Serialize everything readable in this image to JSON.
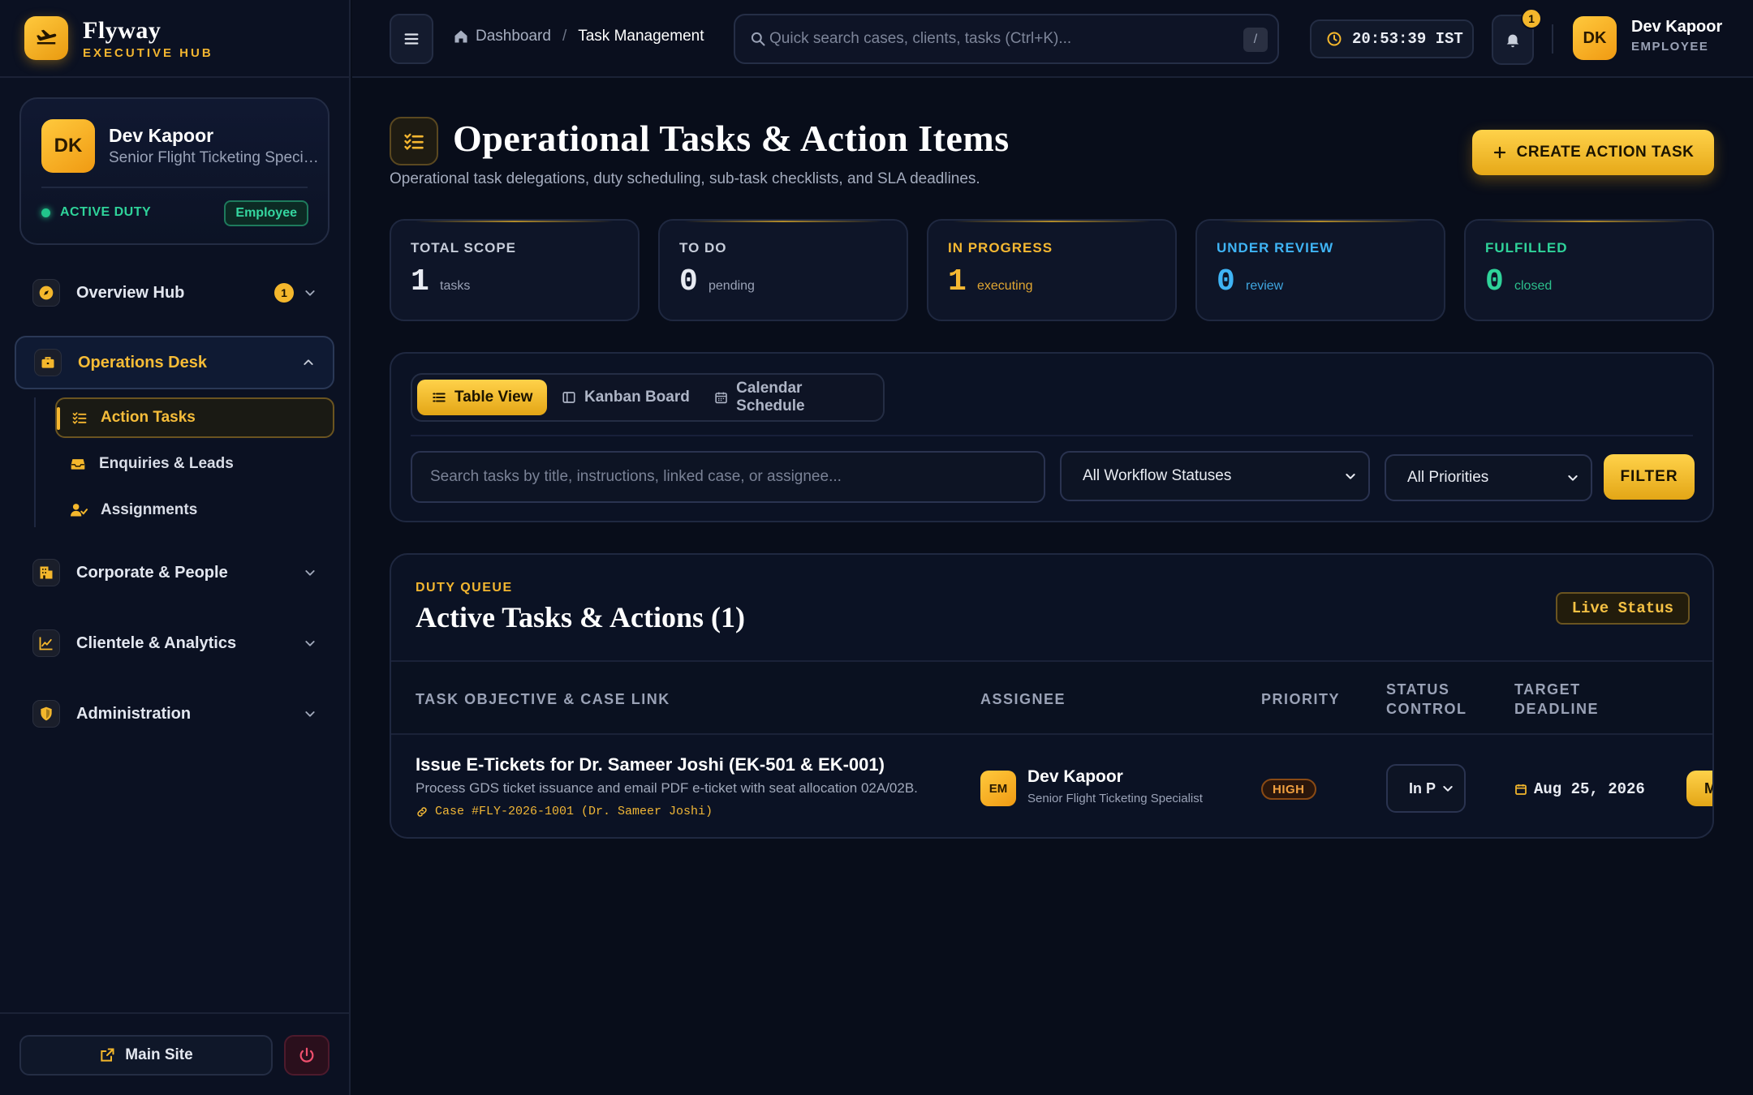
{
  "brand": {
    "name": "Flyway",
    "subtitle": "EXECUTIVE HUB"
  },
  "profile": {
    "initials": "DK",
    "name": "Dev Kapoor",
    "role": "Senior Flight Ticketing Specialist",
    "duty_status": "ACTIVE DUTY",
    "badge": "Employee"
  },
  "nav": {
    "overview": {
      "label": "Overview Hub",
      "count": "1"
    },
    "operations": {
      "label": "Operations Desk",
      "items": [
        {
          "label": "Action Tasks"
        },
        {
          "label": "Enquiries & Leads"
        },
        {
          "label": "Assignments"
        }
      ]
    },
    "corporate": {
      "label": "Corporate & People"
    },
    "clientele": {
      "label": "Clientele & Analytics"
    },
    "administration": {
      "label": "Administration"
    }
  },
  "footer": {
    "main_site": "Main Site"
  },
  "topbar": {
    "breadcrumb_home": "Dashboard",
    "breadcrumb_sep": "/",
    "breadcrumb_current": "Task Management",
    "search_placeholder": "Quick search cases, clients, tasks (Ctrl+K)...",
    "search_shortcut": "/",
    "clock": "20:53:39 IST",
    "notification_count": "1",
    "user_initials": "DK",
    "user_name": "Dev Kapoor",
    "user_role": "EMPLOYEE"
  },
  "page": {
    "title": "Operational Tasks & Action Items",
    "subtitle": "Operational task delegations, duty scheduling, sub-task checklists, and SLA deadlines.",
    "create_button": "CREATE ACTION TASK"
  },
  "stats": [
    {
      "label": "TOTAL SCOPE",
      "value": "1",
      "unit": "tasks",
      "color": "#e8ebf2",
      "label_color": "#c6ccd9",
      "unit_color": "#9aa2b6"
    },
    {
      "label": "TO DO",
      "value": "0",
      "unit": "pending",
      "color": "#e8ebf2",
      "label_color": "#c6ccd9",
      "unit_color": "#9aa2b6"
    },
    {
      "label": "IN PROGRESS",
      "value": "1",
      "unit": "executing",
      "color": "#f5b832",
      "label_color": "#f5b832",
      "unit_color": "#e0a632"
    },
    {
      "label": "UNDER REVIEW",
      "value": "0",
      "unit": "review",
      "color": "#3fb4f5",
      "label_color": "#3fb4f5",
      "unit_color": "#3fa6e0"
    },
    {
      "label": "FULFILLED",
      "value": "0",
      "unit": "closed",
      "color": "#2fd39a",
      "label_color": "#2fd39a",
      "unit_color": "#2cbf8c"
    }
  ],
  "views": [
    {
      "label": "Table View",
      "icon": "list-icon"
    },
    {
      "label": "Kanban Board",
      "icon": "columns-icon"
    },
    {
      "label": "Calendar Schedule",
      "icon": "calendar-icon"
    }
  ],
  "filters": {
    "search_placeholder": "Search tasks by title, instructions, linked case, or assignee...",
    "status_select": "All Workflow Statuses",
    "priority_select": "All Priorities",
    "filter_button": "FILTER"
  },
  "queue": {
    "kicker": "DUTY QUEUE",
    "title": "Active Tasks & Actions (1)",
    "live_badge": "Live Status",
    "columns": {
      "objective": "TASK OBJECTIVE & CASE LINK",
      "assignee": "ASSIGNEE",
      "priority": "PRIORITY",
      "status_line1": "STATUS",
      "status_line2": "CONTROL",
      "deadline_line1": "TARGET",
      "deadline_line2": "DEADLINE"
    },
    "rows": [
      {
        "title": "Issue E-Tickets for Dr. Sameer Joshi (EK-501 & EK-001)",
        "description": "Process GDS ticket issuance and email PDF e-ticket with seat allocation 02A/02B.",
        "case_link": "Case #FLY-2026-1001 (Dr. Sameer Joshi)",
        "assignee_initials": "EM",
        "assignee_name": "Dev Kapoor",
        "assignee_role": "Senior Flight Ticketing Specialist",
        "priority": "HIGH",
        "status": "In P",
        "deadline": "Aug 25, 2026",
        "action": "M"
      }
    ]
  },
  "colors": {
    "accent": "#f5b832",
    "background": "#080d1a",
    "panel": "#0b1224",
    "success": "#2fd39a",
    "info": "#3fb4f5"
  }
}
